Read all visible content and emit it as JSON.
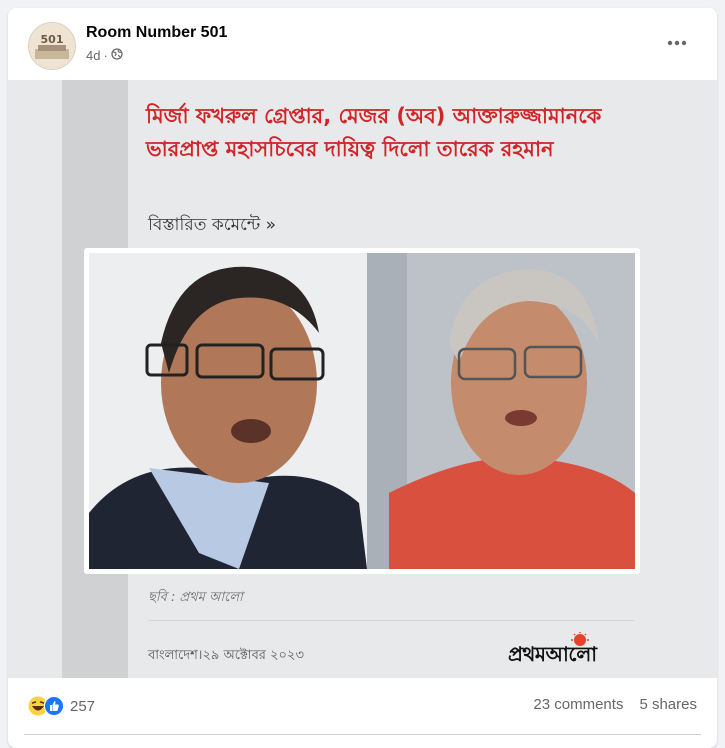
{
  "post": {
    "page_name": "Room Number 501",
    "time_ago": "4d",
    "separator": "·",
    "avatar_text": "501",
    "privacy_icon": "globe-icon",
    "more_icon": "more-horizontal-icon"
  },
  "media": {
    "headline": "মির্জা ফখরুল গ্রেপ্তার, মেজর (অব) আক্তারুজ্জামানকে ভারপ্রাপ্ত মহাসচিবের দায়িত্ব দিলো তারেক রহমান",
    "details": "বিস্তারিত কমেন্টে »",
    "photo_caption": "ছবি : প্রথম আলো",
    "source_line": "বাংলাদেশ।২৯ অক্টোবর ২০২৩",
    "brand": "প্রথমআলো",
    "colors": {
      "headline": "#d2252a",
      "brand_sun": "#e8402a"
    }
  },
  "footer": {
    "reaction_icons": [
      "haha-icon",
      "like-icon"
    ],
    "reaction_count": "257",
    "comments": "23 comments",
    "shares": "5 shares"
  }
}
